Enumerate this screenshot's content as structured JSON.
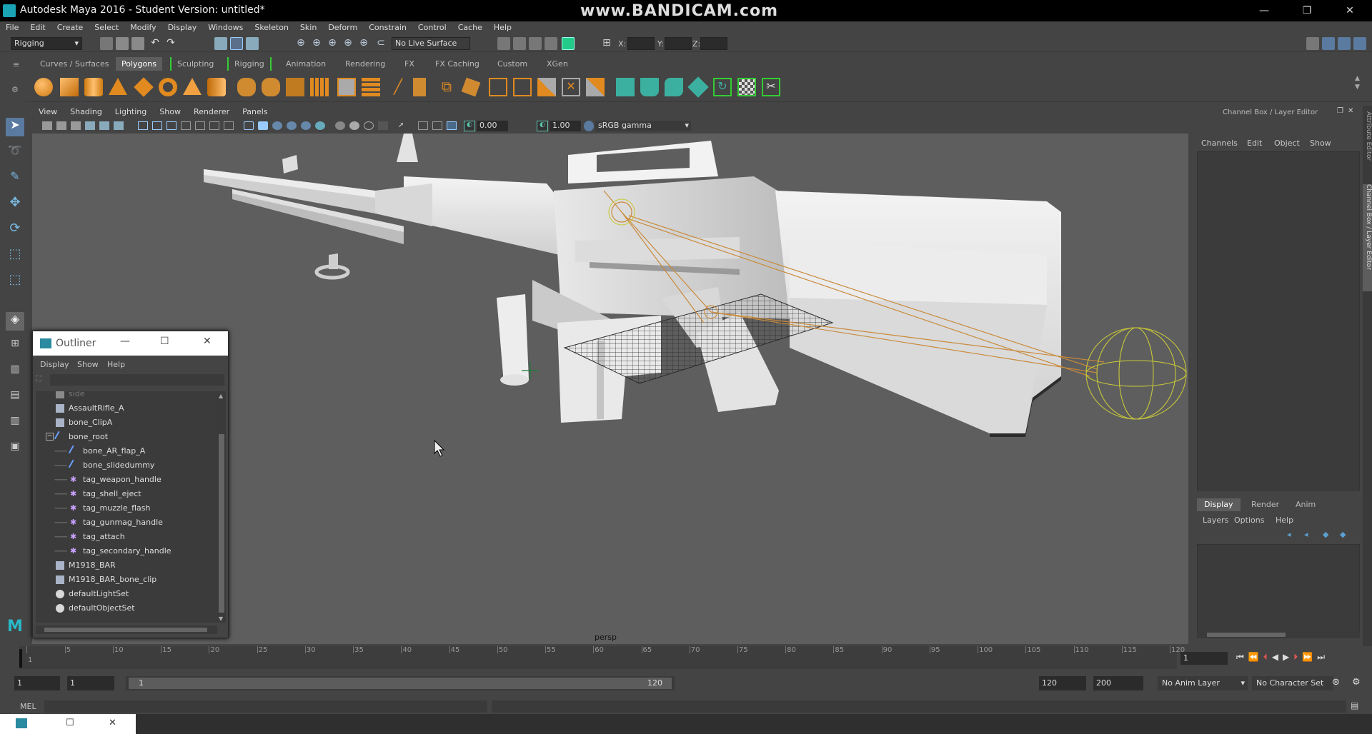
{
  "window": {
    "title": "Autodesk Maya 2016 - Student Version: untitled*",
    "watermark": "www.BANDICAM.com",
    "minimize": "—",
    "maximize": "❐",
    "close": "✕"
  },
  "menubar": [
    "File",
    "Edit",
    "Create",
    "Select",
    "Modify",
    "Display",
    "Windows",
    "Skeleton",
    "Skin",
    "Deform",
    "Constrain",
    "Control",
    "Cache",
    "Help"
  ],
  "statusline": {
    "menuset": "Rigging",
    "live_surface": "No Live Surface",
    "x_label": "X:",
    "y_label": "Y:",
    "z_label": "Z:"
  },
  "shelf_tabs": [
    "Curves / Surfaces",
    "Polygons",
    "Sculpting",
    "Rigging",
    "Animation",
    "Rendering",
    "FX",
    "FX Caching",
    "Custom",
    "XGen"
  ],
  "shelf_selected": "Polygons",
  "viewport": {
    "menus": [
      "View",
      "Shading",
      "Lighting",
      "Show",
      "Renderer",
      "Panels"
    ],
    "exposure": "0.00",
    "gamma": "1.00",
    "colorspace": "sRGB gamma",
    "camera_label": "persp"
  },
  "right_panel": {
    "title": "Channel Box / Layer Editor",
    "menus": [
      "Channels",
      "Edit",
      "Object",
      "Show"
    ],
    "layer_tabs": [
      "Display",
      "Render",
      "Anim"
    ],
    "layer_selected": "Display",
    "layer_menus": [
      "Layers",
      "Options",
      "Help"
    ],
    "side_tabs": [
      "Attribute Editor",
      "Channel Box / Layer Editor"
    ]
  },
  "outliner": {
    "title": "Outliner",
    "menus": [
      "Display",
      "Show",
      "Help"
    ],
    "items": [
      {
        "label": "side",
        "type": "camera",
        "indent": 0
      },
      {
        "label": "AssaultRifle_A",
        "type": "mesh",
        "indent": 0
      },
      {
        "label": "bone_ClipA",
        "type": "mesh",
        "indent": 0
      },
      {
        "label": "bone_root",
        "type": "joint",
        "indent": 0,
        "expanded": true
      },
      {
        "label": "bone_AR_flap_A",
        "type": "joint",
        "indent": 1
      },
      {
        "label": "bone_slidedummy",
        "type": "joint",
        "indent": 1
      },
      {
        "label": "tag_weapon_handle",
        "type": "tag",
        "indent": 1
      },
      {
        "label": "tag_shell_eject",
        "type": "tag",
        "indent": 1
      },
      {
        "label": "tag_muzzle_flash",
        "type": "tag",
        "indent": 1
      },
      {
        "label": "tag_gunmag_handle",
        "type": "tag",
        "indent": 1
      },
      {
        "label": "tag_attach",
        "type": "tag",
        "indent": 1
      },
      {
        "label": "tag_secondary_handle",
        "type": "tag",
        "indent": 1
      },
      {
        "label": "M1918_BAR",
        "type": "mesh",
        "indent": 0
      },
      {
        "label": "M1918_BAR_bone_clip",
        "type": "mesh",
        "indent": 0
      },
      {
        "label": "defaultLightSet",
        "type": "set",
        "indent": 0
      },
      {
        "label": "defaultObjectSet",
        "type": "set",
        "indent": 0
      }
    ]
  },
  "timeline": {
    "ticks": [
      "1",
      "5",
      "10",
      "15",
      "20",
      "25",
      "30",
      "35",
      "40",
      "45",
      "50",
      "55",
      "60",
      "65",
      "70",
      "75",
      "80",
      "85",
      "90",
      "95",
      "100",
      "105",
      "110",
      "115",
      "120"
    ],
    "current_frame": "1"
  },
  "range": {
    "start": "1",
    "playback_start": "1",
    "slider_start": "1",
    "slider_end": "120",
    "playback_end": "120",
    "end": "200",
    "anim_layer": "No Anim Layer",
    "character_set": "No Character Set"
  },
  "cmdline": {
    "label": "MEL"
  },
  "colors": {
    "accent": "#5fc5b0",
    "joint": "#c98a3a",
    "selection": "#c8c83a"
  }
}
